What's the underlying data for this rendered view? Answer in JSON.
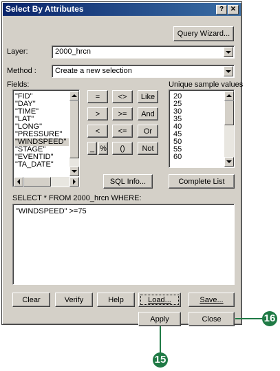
{
  "window": {
    "title": "Select By Attributes",
    "help_label": "?",
    "close_label": "✕"
  },
  "query_wizard_label": "Query Wizard...",
  "layer": {
    "label": "Layer:",
    "value": "2000_hrcn"
  },
  "method": {
    "label": "Method :",
    "value": "Create a new selection"
  },
  "fields": {
    "label": "Fields:",
    "items": [
      "\"FID\"",
      "\"DAY\"",
      "\"TIME\"",
      "\"LAT\"",
      "\"LONG\"",
      "\"PRESSURE\"",
      "\"WINDSPEED\"",
      "\"STAGE\"",
      "\"EVENTID\"",
      "\"TA_DATE\""
    ],
    "selected": "\"WINDSPEED\""
  },
  "operators": {
    "eq": "=",
    "ne": "<>",
    "like": "Like",
    "gt": ">",
    "ge": ">=",
    "and": "And",
    "lt": "<",
    "le": "<=",
    "or": "Or",
    "underscore": "_",
    "percent": "%",
    "parens": "()",
    "not": "Not"
  },
  "unique_values": {
    "label": "Unique sample values",
    "items": [
      "20",
      "25",
      "30",
      "35",
      "40",
      "45",
      "50",
      "55",
      "60"
    ]
  },
  "sql_info_label": "SQL Info...",
  "complete_list_label": "Complete List",
  "query_prefix": "SELECT * FROM 2000_hrcn WHERE:",
  "query_text": "\"WINDSPEED\" >=75",
  "bottom_buttons": {
    "clear": "Clear",
    "verify": "Verify",
    "help": "Help",
    "load": "Load...",
    "save": "Save...",
    "apply": "Apply",
    "close": "Close"
  },
  "callouts": {
    "apply_step": "15",
    "close_step": "16"
  },
  "colors": {
    "callout": "#1f7a45",
    "titlebar": "#0a246a",
    "dialog": "#d4d0c8"
  }
}
